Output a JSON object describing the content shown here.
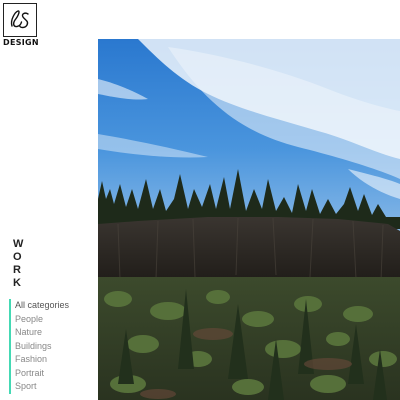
{
  "logo": {
    "monogram": "LS",
    "word": "DESIGN"
  },
  "section": {
    "heading_letters": [
      "W",
      "O",
      "R",
      "K"
    ]
  },
  "categories": [
    {
      "label": "All categories"
    },
    {
      "label": "People"
    },
    {
      "label": "Nature"
    },
    {
      "label": "Buildings"
    },
    {
      "label": "Fashion"
    },
    {
      "label": "Portrait"
    },
    {
      "label": "Sport"
    }
  ],
  "colors": {
    "accent": "#44d9b4",
    "sky": "#2f7fd1",
    "text_muted": "#888888"
  },
  "hero": {
    "subject": "landscape photo: basalt cliff with pine trees under a blue sky with streaky clouds"
  }
}
